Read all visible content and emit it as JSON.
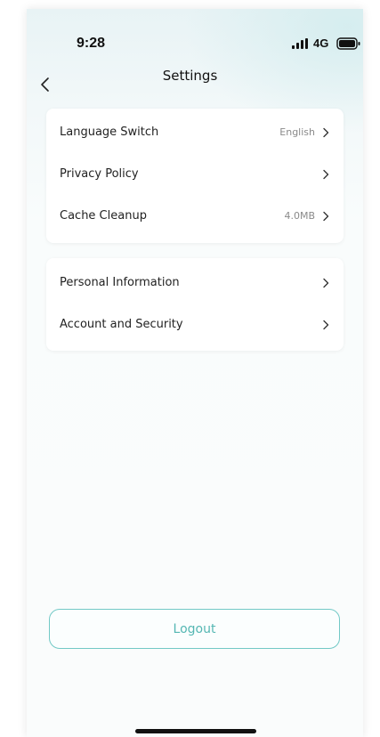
{
  "status_bar": {
    "time": "9:28",
    "network": "4G"
  },
  "header": {
    "title": "Settings",
    "back_icon": "chevron-left-icon"
  },
  "groups": [
    {
      "items": [
        {
          "label": "Language Switch",
          "value": "English"
        },
        {
          "label": "Privacy Policy",
          "value": ""
        },
        {
          "label": "Cache Cleanup",
          "value": "4.0MB"
        }
      ]
    },
    {
      "items": [
        {
          "label": "Personal Information",
          "value": ""
        },
        {
          "label": "Account and Security",
          "value": ""
        }
      ]
    }
  ],
  "logout": {
    "label": "Logout"
  },
  "colors": {
    "accent": "#55b7b3",
    "accent_border": "#72c9c6",
    "background_tint": "#e8f3f5"
  }
}
